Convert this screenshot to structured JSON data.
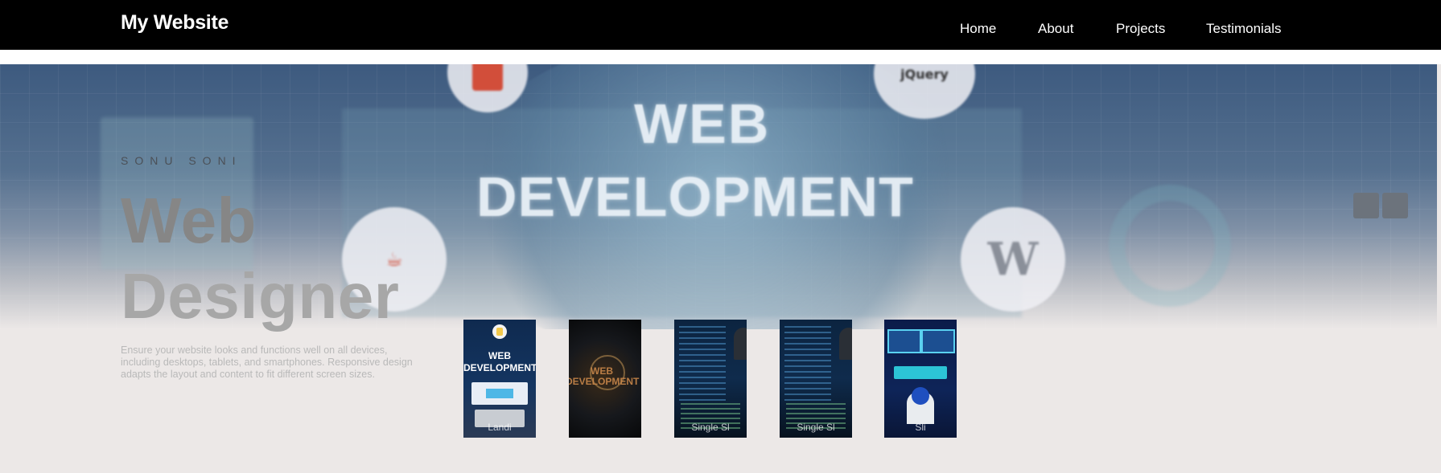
{
  "site": {
    "logo": "My Website"
  },
  "nav": {
    "items": [
      {
        "label": "Home"
      },
      {
        "label": "About"
      },
      {
        "label": "Projects"
      },
      {
        "label": "Testimonials"
      }
    ]
  },
  "hero": {
    "banner_title_line1": "WEB",
    "banner_title_line2": "DEVELOPMENT",
    "subtitle": "SONU SONI",
    "headline_line1": "Web",
    "headline_line2": "Designer",
    "description": "Ensure your website looks and functions well on all devices, including desktops, tablets, and smartphones. Responsive design adapts the layout and content to fit different screen sizes."
  },
  "thumbnails": [
    {
      "title_line1": "WEB",
      "title_line2": "DEVELOPMENT",
      "caption": "Landi"
    },
    {
      "title_line1": "WEB",
      "title_line2": "DEVELOPMENT",
      "caption": ""
    },
    {
      "title_line1": "",
      "title_line2": "",
      "caption": "Single Sl"
    },
    {
      "title_line1": "",
      "title_line2": "",
      "caption": "Single Sl"
    },
    {
      "title_line1": "",
      "title_line2": "",
      "caption": "Sli"
    }
  ],
  "colors": {
    "header_bg": "#000000",
    "hero_bg": "#ece8e7",
    "slider_button": "#6c737c",
    "headline": "#868686"
  },
  "icons": {
    "slider_prev": "chevron-left-icon",
    "slider_next": "chevron-right-icon"
  }
}
